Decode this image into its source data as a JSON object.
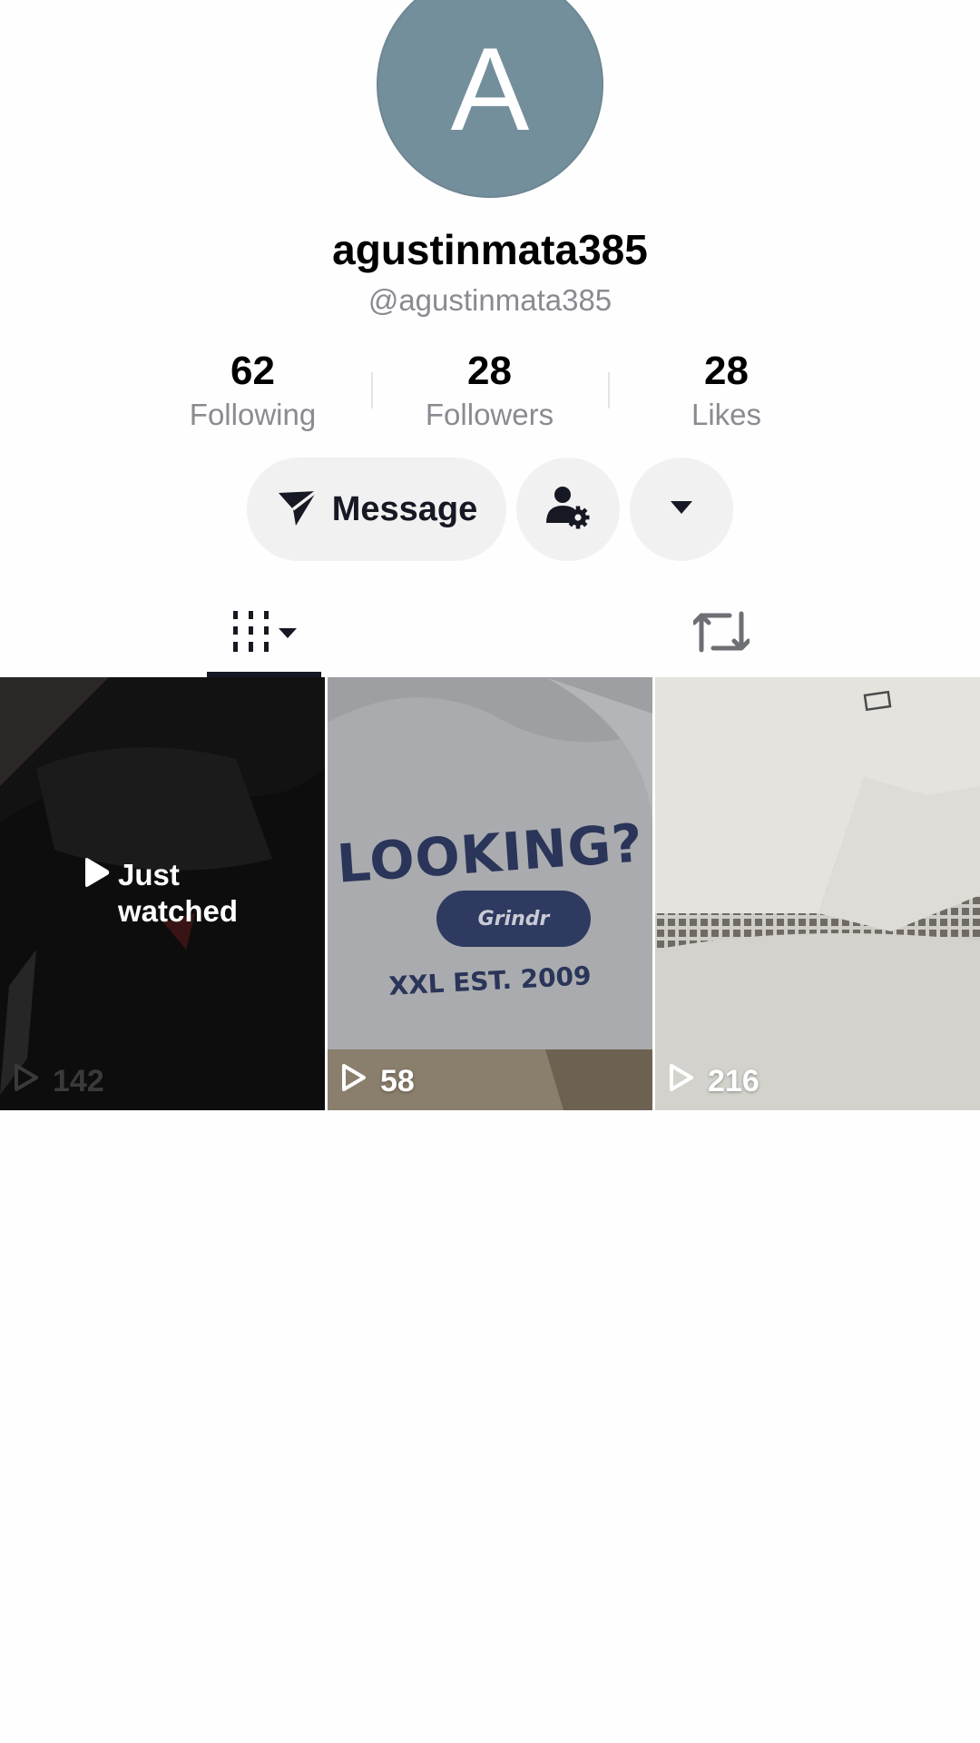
{
  "profile": {
    "avatar_letter": "A",
    "avatar_color": "#748f9c",
    "display_name": "agustinmata385",
    "handle": "@agustinmata385"
  },
  "stats": [
    {
      "value": "62",
      "label": "Following"
    },
    {
      "value": "28",
      "label": "Followers"
    },
    {
      "value": "28",
      "label": "Likes"
    }
  ],
  "actions": {
    "message_label": "Message",
    "message_icon": "send-icon",
    "follow_settings_icon": "user-gear-icon",
    "more_icon": "caret-down-icon"
  },
  "tabs": {
    "videos_icon": "grid-columns-icon",
    "reposts_icon": "repost-icon",
    "active": "videos"
  },
  "videos": [
    {
      "views": "142",
      "overlay": "Just watched",
      "thumbnail_color": "#141414"
    },
    {
      "views": "58",
      "thumbnail_color": "#a4a6a9",
      "print": {
        "headline": "LOOKING?",
        "badge": "Grindr",
        "footer": "XXL  EST. 2009"
      }
    },
    {
      "views": "216",
      "thumbnail_color": "#d6d5d0"
    }
  ]
}
